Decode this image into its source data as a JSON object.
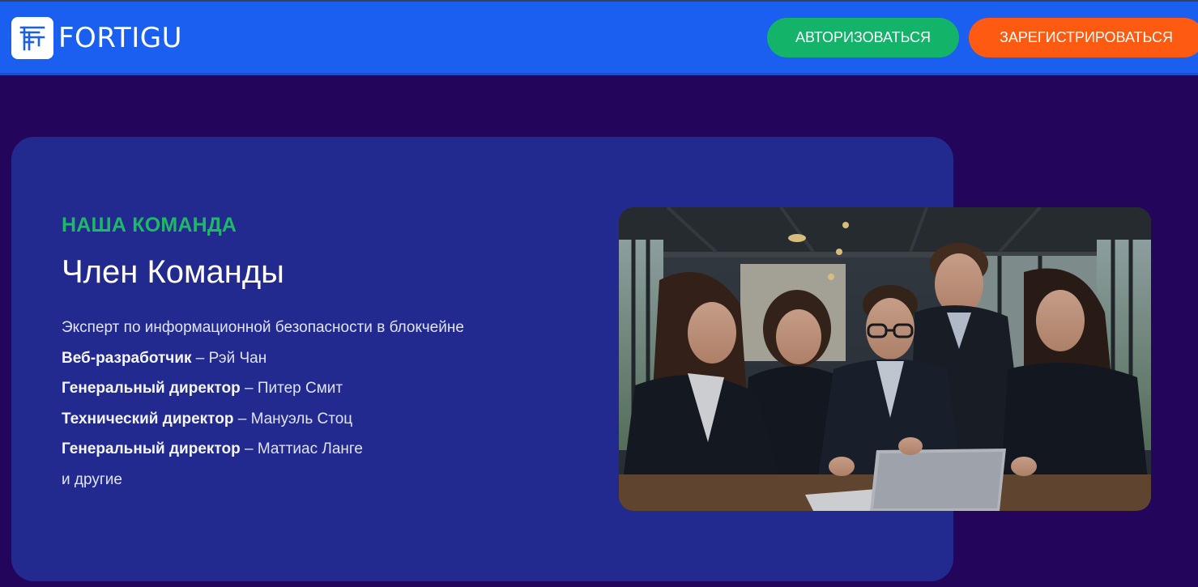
{
  "header": {
    "brand": "FORTIGU",
    "login_label": "АВТОРИЗОВАТЬСЯ",
    "register_label": "ЗАРЕГИСТРИРОВАТЬСЯ"
  },
  "team": {
    "eyebrow": "НАША КОМАНДА",
    "title": "Член Команды",
    "intro": "Эксперт по информационной безопасности в блокчейне",
    "members": [
      {
        "role": "Веб-разработчик",
        "sep": " – ",
        "name": "Рэй Чан"
      },
      {
        "role": "Генеральный директор",
        "sep": " – ",
        "name": "Питер Смит"
      },
      {
        "role": "Технический директор",
        "sep": " – ",
        "name": "Мануэль Стоц"
      },
      {
        "role": "Генеральный директор",
        "sep": " – ",
        "name": "Маттиас Ланге"
      }
    ],
    "outro": "и другие"
  },
  "colors": {
    "page_bg": "#23065c",
    "header_bg": "#1a5ff0",
    "card_bg": "#232a8f",
    "accent_green": "#1fb866",
    "login_bg": "#14b36a",
    "register_bg": "#ff5a12"
  }
}
